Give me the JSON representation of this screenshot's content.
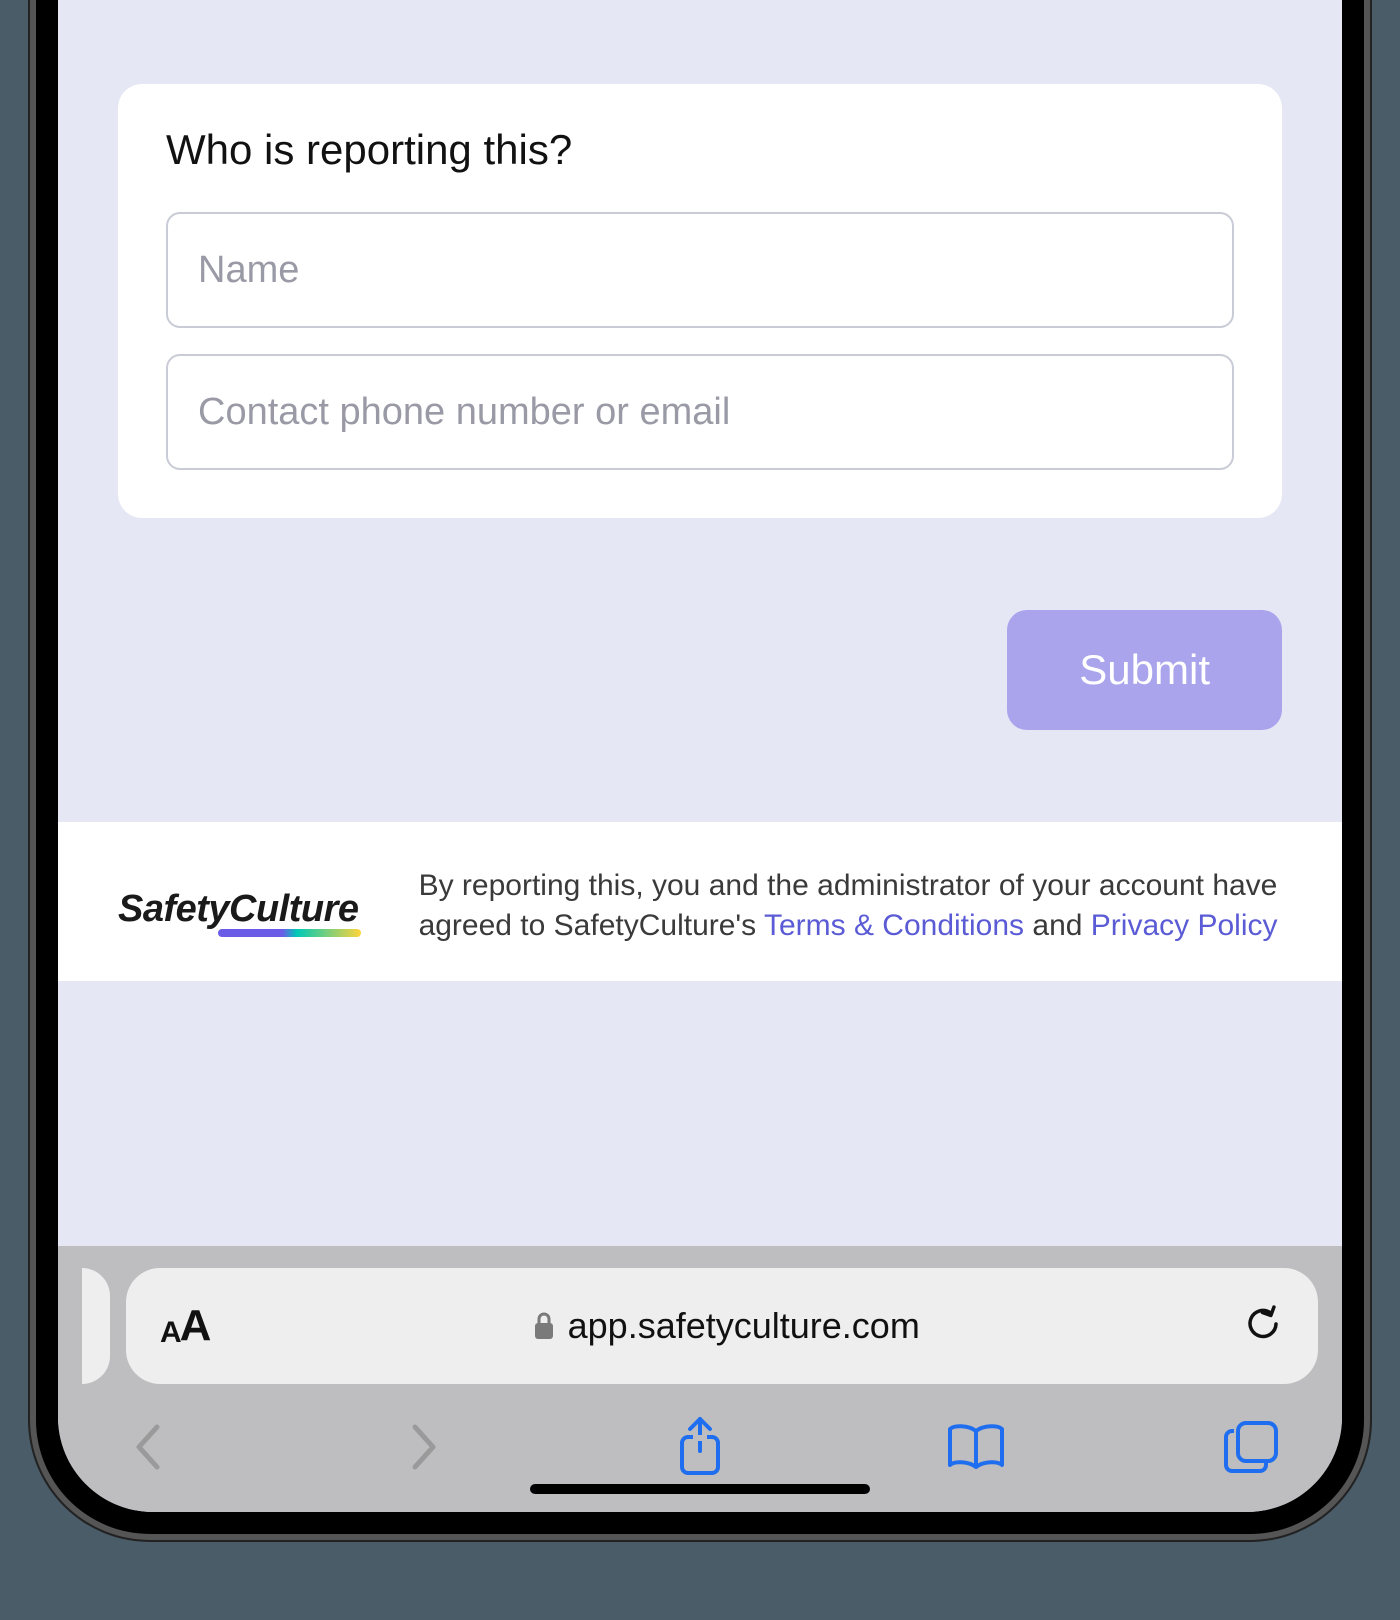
{
  "form": {
    "card_title": "Who is reporting this?",
    "name_placeholder": "Name",
    "contact_placeholder": "Contact phone number or email",
    "submit_label": "Submit"
  },
  "footer": {
    "brand": "SafetyCulture",
    "legal_intro": "By reporting this, you and the administrator of your account have agreed to SafetyCulture's ",
    "terms_label": "Terms & Conditions",
    "and_word": " and ",
    "privacy_label": "Privacy Policy"
  },
  "safari": {
    "url": "app.safetyculture.com"
  }
}
